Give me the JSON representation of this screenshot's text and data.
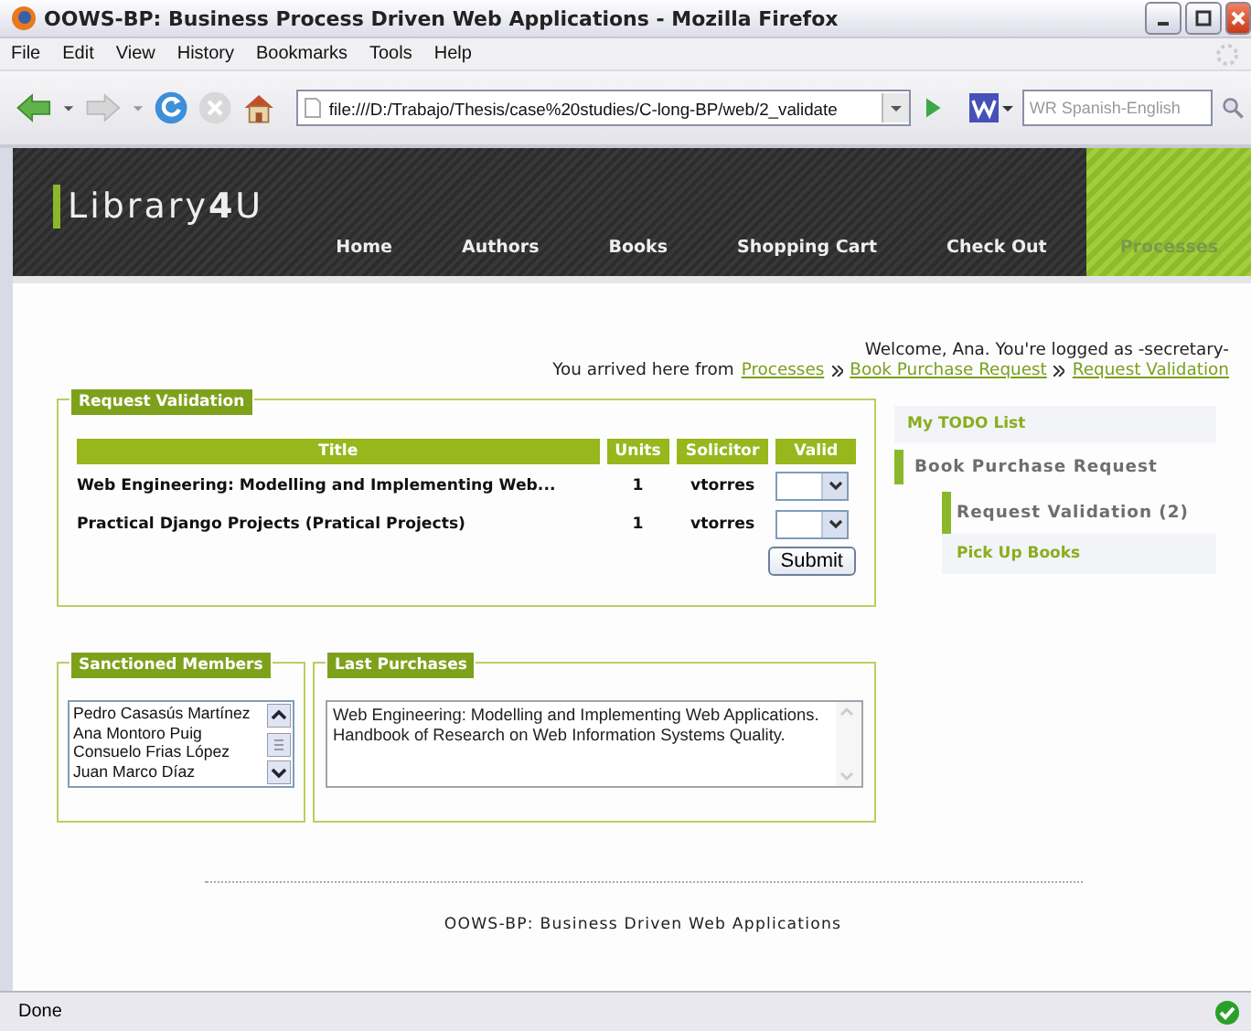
{
  "window": {
    "title": "OOWS-BP: Business Process Driven Web Applications - Mozilla Firefox"
  },
  "menu": [
    "File",
    "Edit",
    "View",
    "History",
    "Bookmarks",
    "Tools",
    "Help"
  ],
  "address": {
    "value": "file:///D:/Trabajo/Thesis/case%20studies/C-long-BP/web/2_validate"
  },
  "search": {
    "placeholder": "WR Spanish-English"
  },
  "site": {
    "logo": "Library**4**U",
    "nav": [
      {
        "label": "Home",
        "selected": false
      },
      {
        "label": "Authors",
        "selected": false
      },
      {
        "label": "Books",
        "selected": false
      },
      {
        "label": "Shopping Cart",
        "selected": false
      },
      {
        "label": "Check Out",
        "selected": false
      },
      {
        "label": "Processes",
        "selected": true
      }
    ]
  },
  "welcome": "Welcome, Ana. You're logged as -secretary-",
  "breadcrumb": {
    "prefix": "You arrived here from",
    "links": [
      "Processes",
      "Book Purchase Request",
      "Request Validation"
    ]
  },
  "request_validation": {
    "legend": "Request Validation",
    "columns": [
      "Title",
      "Units",
      "Solicitor",
      "Valid"
    ],
    "rows": [
      {
        "title": "Web Engineering: Modelling and Implementing Web...",
        "units": "1",
        "solicitor": "vtorres"
      },
      {
        "title": "Practical Django Projects (Pratical Projects)",
        "units": "1",
        "solicitor": "vtorres"
      }
    ],
    "submit": "Submit"
  },
  "todo": {
    "heading": "My TODO List",
    "items": [
      {
        "label": "Book Purchase Request",
        "selected": true,
        "children": [
          {
            "label": "Request Validation (2)",
            "selected": true
          },
          {
            "label": "Pick Up Books",
            "selected": false
          }
        ]
      }
    ]
  },
  "sanctioned": {
    "legend": "Sanctioned Members",
    "members": [
      "Pedro Casasús Martínez",
      "Ana Montoro Puig",
      "Consuelo Frias López",
      "Juan Marco Díaz"
    ]
  },
  "last_purchases": {
    "legend": "Last Purchases",
    "lines": [
      "Web Engineering: Modelling and Implementing Web Applications.",
      "Handbook of Research on Web Information Systems Quality."
    ]
  },
  "footer": "OOWS-BP: Business Driven Web Applications",
  "status_bar": {
    "text": "Done"
  }
}
